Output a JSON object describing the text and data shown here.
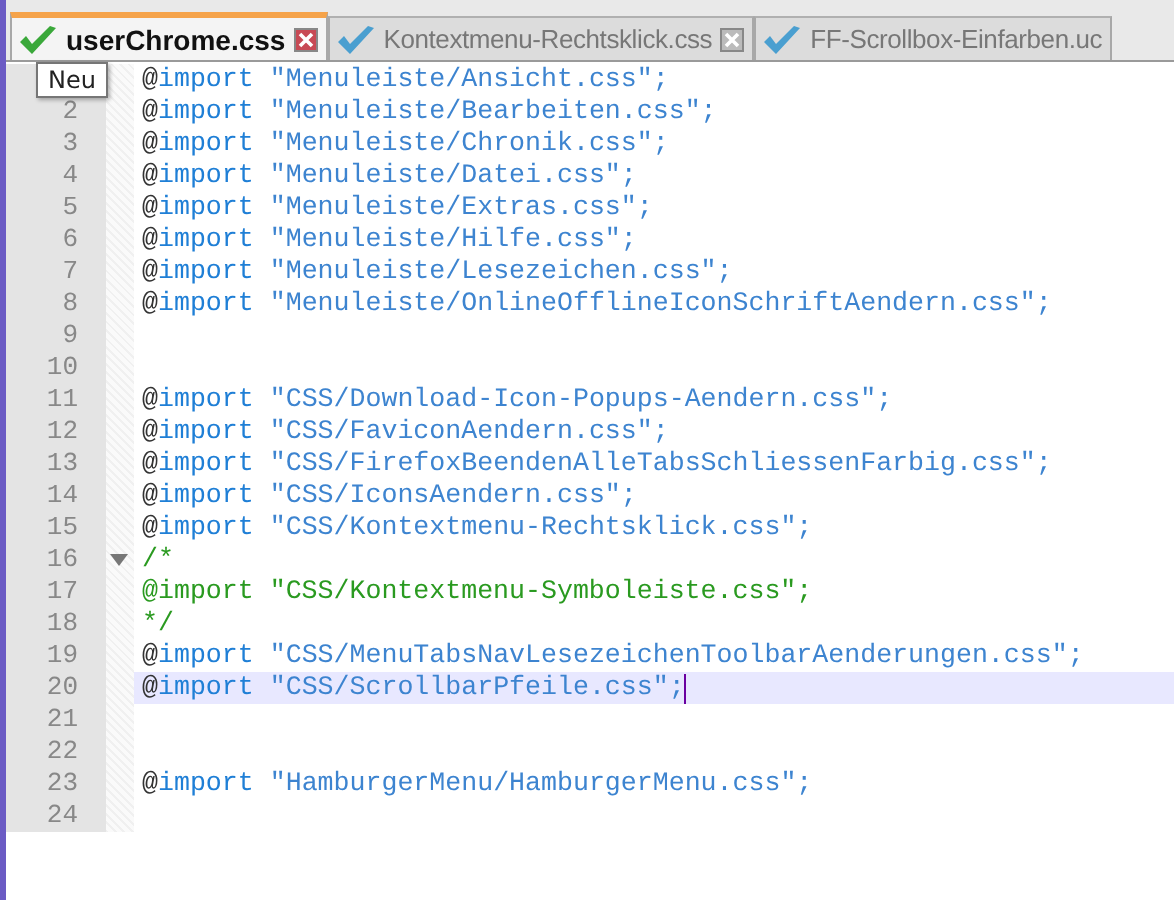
{
  "tabs": [
    {
      "label": "userChrome.css",
      "selected": true,
      "closable": true
    },
    {
      "label": "Kontextmenu-Rechtsklick.css",
      "selected": false,
      "closable": true
    },
    {
      "label": "FF-Scrollbox-Einfarben.uc",
      "selected": false,
      "closable": false
    }
  ],
  "tooltip": "Neu",
  "lines": [
    {
      "kind": "import",
      "at": "@",
      "keyword": "import",
      "string": "\"Menuleiste/Ansicht.css\";",
      "selected": false,
      "fold": false
    },
    {
      "number": "2",
      "kind": "import",
      "at": "@",
      "keyword": "import",
      "string": "\"Menuleiste/Bearbeiten.css\";",
      "selected": false,
      "fold": false
    },
    {
      "number": "3",
      "kind": "import",
      "at": "@",
      "keyword": "import",
      "string": "\"Menuleiste/Chronik.css\";",
      "selected": false,
      "fold": false
    },
    {
      "number": "4",
      "kind": "import",
      "at": "@",
      "keyword": "import",
      "string": "\"Menuleiste/Datei.css\";",
      "selected": false,
      "fold": false
    },
    {
      "number": "5",
      "kind": "import",
      "at": "@",
      "keyword": "import",
      "string": "\"Menuleiste/Extras.css\";",
      "selected": false,
      "fold": false
    },
    {
      "number": "6",
      "kind": "import",
      "at": "@",
      "keyword": "import",
      "string": "\"Menuleiste/Hilfe.css\";",
      "selected": false,
      "fold": false
    },
    {
      "number": "7",
      "kind": "import",
      "at": "@",
      "keyword": "import",
      "string": "\"Menuleiste/Lesezeichen.css\";",
      "selected": false,
      "fold": false
    },
    {
      "number": "8",
      "kind": "import",
      "at": "@",
      "keyword": "import",
      "string": "\"Menuleiste/OnlineOfflineIconSchriftAendern.css\";",
      "selected": false,
      "fold": false
    },
    {
      "number": "9",
      "kind": "blank",
      "selected": false,
      "fold": false
    },
    {
      "number": "10",
      "kind": "blank",
      "selected": false,
      "fold": false
    },
    {
      "number": "11",
      "kind": "import",
      "at": "@",
      "keyword": "import",
      "string": "\"CSS/Download-Icon-Popups-Aendern.css\";",
      "selected": false,
      "fold": false
    },
    {
      "number": "12",
      "kind": "import",
      "at": "@",
      "keyword": "import",
      "string": "\"CSS/FaviconAendern.css\";",
      "selected": false,
      "fold": false
    },
    {
      "number": "13",
      "kind": "import",
      "at": "@",
      "keyword": "import",
      "string": "\"CSS/FirefoxBeendenAlleTabsSchliessenFarbig.css\";",
      "selected": false,
      "fold": false
    },
    {
      "number": "14",
      "kind": "import",
      "at": "@",
      "keyword": "import",
      "string": "\"CSS/IconsAendern.css\";",
      "selected": false,
      "fold": false
    },
    {
      "number": "15",
      "kind": "import",
      "at": "@",
      "keyword": "import",
      "string": "\"CSS/Kontextmenu-Rechtsklick.css\";",
      "selected": false,
      "fold": false
    },
    {
      "number": "16",
      "kind": "comment",
      "text": "/*",
      "selected": false,
      "fold": true
    },
    {
      "number": "17",
      "kind": "comment",
      "text": "@import \"CSS/Kontextmenu-Symboleiste.css\";",
      "selected": false,
      "fold": false
    },
    {
      "number": "18",
      "kind": "comment",
      "text": "*/",
      "selected": false,
      "fold": false
    },
    {
      "number": "19",
      "kind": "import",
      "at": "@",
      "keyword": "import",
      "string": "\"CSS/MenuTabsNavLesezeichenToolbarAenderungen.css\";",
      "selected": false,
      "fold": false
    },
    {
      "number": "20",
      "kind": "import",
      "at": "@",
      "keyword": "import",
      "string": "\"CSS/ScrollbarPfeile.css\";",
      "selected": true,
      "fold": false
    },
    {
      "number": "21",
      "kind": "blank",
      "selected": false,
      "fold": false
    },
    {
      "number": "22",
      "kind": "blank",
      "selected": false,
      "fold": false
    },
    {
      "number": "23",
      "kind": "import",
      "at": "@",
      "keyword": "import",
      "string": "\"HamburgerMenu/HamburgerMenu.css\";",
      "selected": false,
      "fold": false
    },
    {
      "number": "24",
      "kind": "blank",
      "selected": false,
      "fold": false
    }
  ]
}
